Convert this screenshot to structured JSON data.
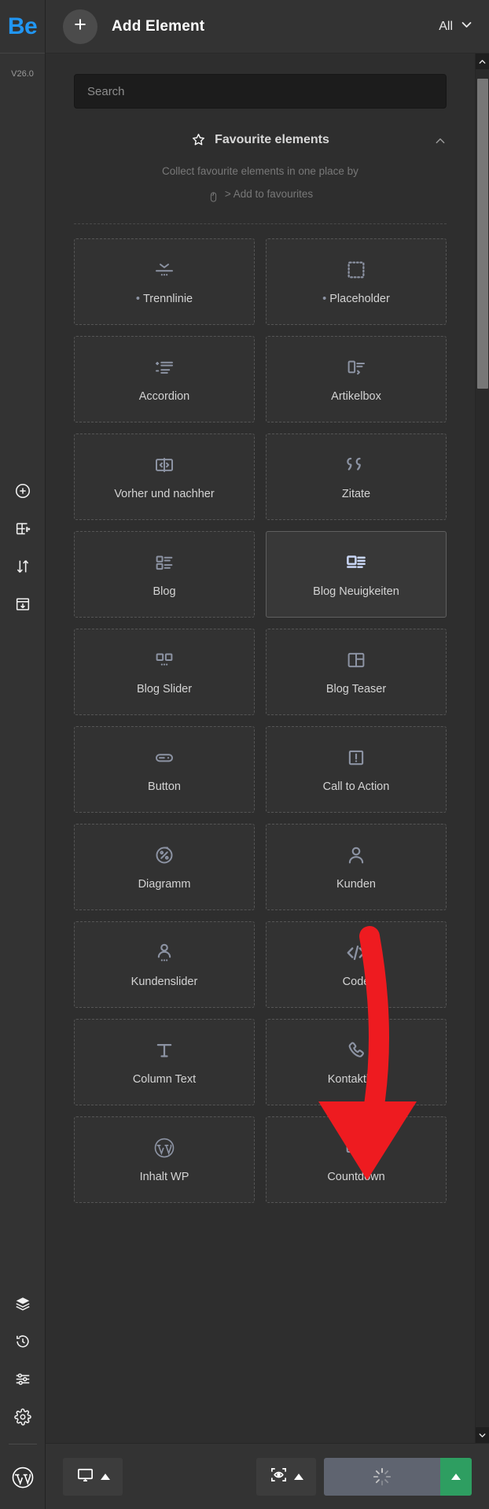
{
  "app": {
    "logo_text": "Be",
    "version": "V26.0"
  },
  "rail": {
    "top_icons": [
      {
        "name": "add-circle-icon",
        "label": "Add"
      },
      {
        "name": "add-section-icon",
        "label": "Add section"
      },
      {
        "name": "sort-arrows-icon",
        "label": "Reorder"
      },
      {
        "name": "import-template-icon",
        "label": "Import template"
      }
    ],
    "bottom_icons": [
      {
        "name": "layers-icon",
        "label": "Layers"
      },
      {
        "name": "history-icon",
        "label": "History"
      },
      {
        "name": "sliders-icon",
        "label": "Settings sliders"
      },
      {
        "name": "gear-icon",
        "label": "Options"
      }
    ],
    "wordpress_icon": "wordpress-icon"
  },
  "topbar": {
    "add_icon": "plus-icon",
    "title": "Add Element",
    "filter_label": "All",
    "filter_icon": "chevron-down-icon"
  },
  "search": {
    "placeholder": "Search",
    "value": ""
  },
  "favourites": {
    "star_icon": "star-icon",
    "title": "Favourite elements",
    "collapse_icon": "chevron-up-icon",
    "hint_line1": "Collect favourite elements in one place by",
    "hint_icon": "mouse-icon",
    "hint_line2": "> Add to favourites"
  },
  "elements": [
    {
      "label": "Trennlinie",
      "icon": "divider-icon",
      "bullet": true,
      "selected": false
    },
    {
      "label": "Placeholder",
      "icon": "placeholder-icon",
      "bullet": true,
      "selected": false
    },
    {
      "label": "Accordion",
      "icon": "accordion-icon",
      "bullet": false,
      "selected": false
    },
    {
      "label": "Artikelbox",
      "icon": "article-box-icon",
      "bullet": false,
      "selected": false
    },
    {
      "label": "Vorher und nachher",
      "icon": "before-after-icon",
      "bullet": false,
      "selected": false
    },
    {
      "label": "Zitate",
      "icon": "quotes-icon",
      "bullet": false,
      "selected": false
    },
    {
      "label": "Blog",
      "icon": "blog-list-icon",
      "bullet": false,
      "selected": false
    },
    {
      "label": "Blog Neuigkeiten",
      "icon": "blog-news-icon",
      "bullet": false,
      "selected": true
    },
    {
      "label": "Blog Slider",
      "icon": "blog-slider-icon",
      "bullet": false,
      "selected": false
    },
    {
      "label": "Blog Teaser",
      "icon": "blog-teaser-icon",
      "bullet": false,
      "selected": false
    },
    {
      "label": "Button",
      "icon": "button-icon",
      "bullet": false,
      "selected": false
    },
    {
      "label": "Call to Action",
      "icon": "call-to-action-icon",
      "bullet": false,
      "selected": false
    },
    {
      "label": "Diagramm",
      "icon": "chart-percent-icon",
      "bullet": false,
      "selected": false
    },
    {
      "label": "Kunden",
      "icon": "person-icon",
      "bullet": false,
      "selected": false
    },
    {
      "label": "Kundenslider",
      "icon": "person-slider-icon",
      "bullet": false,
      "selected": false
    },
    {
      "label": "Code",
      "icon": "code-icon",
      "bullet": false,
      "selected": false
    },
    {
      "label": "Column Text",
      "icon": "text-t-icon",
      "bullet": false,
      "selected": false
    },
    {
      "label": "Kontaktbox",
      "icon": "phone-icon",
      "bullet": false,
      "selected": false
    },
    {
      "label": "Inhalt WP",
      "icon": "wordpress-icon",
      "bullet": false,
      "selected": false
    },
    {
      "label": "Countdown",
      "icon": "countdown-icon",
      "bullet": false,
      "selected": false
    }
  ],
  "scrollbar": {
    "up_icon": "chevron-up-icon",
    "down_icon": "chevron-down-icon"
  },
  "bottombar": {
    "device_button": {
      "icon": "monitor-icon",
      "caret": "caret-up-icon"
    },
    "preview_button": {
      "icon": "focus-eye-icon",
      "caret": "caret-up-icon"
    },
    "update_button": {
      "icon": "spinner-icon",
      "caret": "caret-up-icon"
    }
  },
  "colors": {
    "brand": "#2196f3",
    "panel": "#2e2e2e",
    "rail": "#333333",
    "accent_green": "#2e9e61",
    "update_grey": "#5f6470",
    "arrow_red": "#ee1b20",
    "tile_icon": "#8c93a3",
    "selected_icon": "#c9d6f5"
  }
}
